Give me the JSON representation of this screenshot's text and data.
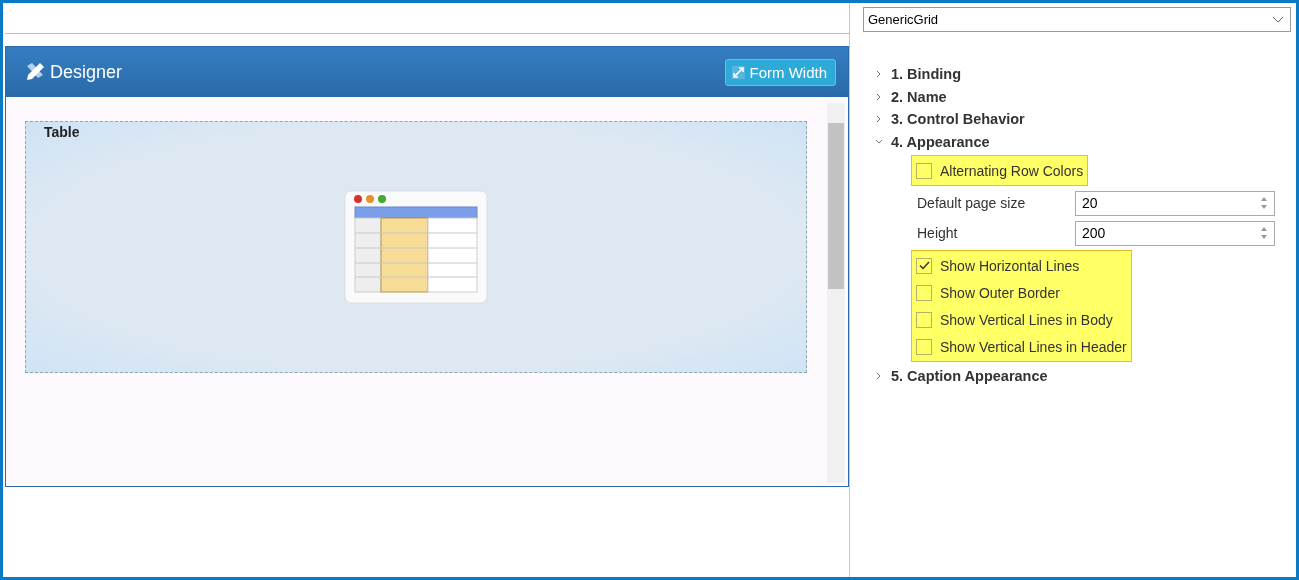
{
  "designer": {
    "title": "Designer",
    "button": "Form Width",
    "canvas_label": "Table"
  },
  "properties": {
    "dropdown": "GenericGrid",
    "sections": [
      {
        "label": "1. Binding",
        "expanded": false
      },
      {
        "label": "2. Name",
        "expanded": false
      },
      {
        "label": "3. Control Behavior",
        "expanded": false
      },
      {
        "label": "4. Appearance",
        "expanded": true,
        "children": [
          {
            "kind": "checkboxes",
            "highlighted": true,
            "options": [
              {
                "label": "Alternating Row Colors",
                "checked": false
              }
            ]
          },
          {
            "kind": "number",
            "label": "Default page size",
            "value": "20"
          },
          {
            "kind": "number",
            "label": "Height",
            "value": "200"
          },
          {
            "kind": "checkboxes",
            "highlighted": true,
            "options": [
              {
                "label": "Show Horizontal Lines",
                "checked": true
              },
              {
                "label": "Show Outer Border",
                "checked": false
              },
              {
                "label": "Show Vertical Lines in Body",
                "checked": false
              },
              {
                "label": "Show Vertical Lines in Header",
                "checked": false
              }
            ]
          }
        ]
      },
      {
        "label": "5. Caption Appearance",
        "expanded": false
      }
    ]
  }
}
